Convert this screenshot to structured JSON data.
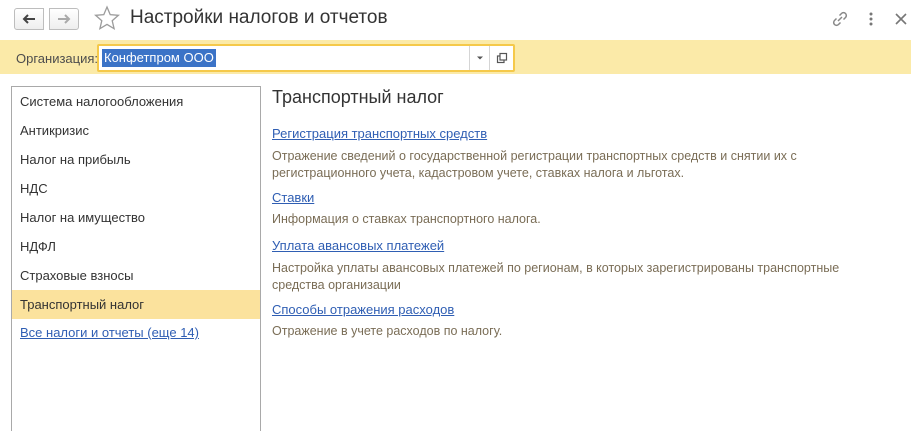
{
  "window": {
    "title": "Настройки налогов и отчетов"
  },
  "organization": {
    "label": "Организация:",
    "value": "Конфетпром ООО"
  },
  "sidebar": {
    "items": [
      {
        "label": "Система налогообложения"
      },
      {
        "label": "Антикризис"
      },
      {
        "label": "Налог на прибыль"
      },
      {
        "label": "НДС"
      },
      {
        "label": "Налог на имущество"
      },
      {
        "label": "НДФЛ"
      },
      {
        "label": "Страховые взносы"
      },
      {
        "label": "Транспортный налог"
      }
    ],
    "all_link": "Все налоги и отчеты (еще 14)"
  },
  "main": {
    "title": "Транспортный налог",
    "entries": [
      {
        "link": "Регистрация транспортных средств",
        "desc_lines": [
          "Отражение сведений о государственной регистрации транспортных средств и снятии их с",
          "регистрационного учета, кадастровом учете, ставках налога и льготах."
        ]
      },
      {
        "link": "Ставки",
        "desc_lines": [
          "Информация о ставках транспортного налога."
        ]
      },
      {
        "link": "Уплата авансовых платежей",
        "desc_lines": [
          "Настройка уплаты авансовых платежей по регионам, в которых зарегистрированы транспортные",
          "средства организации"
        ]
      },
      {
        "link": "Способы отражения расходов",
        "desc_lines": [
          "Отражение в учете расходов по налогу."
        ]
      }
    ]
  },
  "colors": {
    "accent_strip": "#fbeaa8",
    "active_item": "#fbe29d",
    "link": "#2f5eb3",
    "description": "#7a6d56",
    "selection": "#3b73c7"
  },
  "icons": {
    "back": "arrow-left-icon",
    "forward": "arrow-right-icon",
    "favorite": "star-icon",
    "link": "link-icon",
    "more": "more-vertical-icon",
    "close": "close-icon",
    "dropdown": "chevron-down-icon",
    "open": "open-window-icon"
  }
}
